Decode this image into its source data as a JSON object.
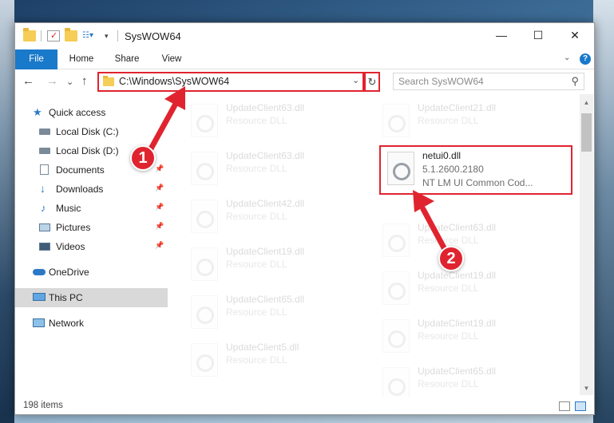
{
  "window": {
    "title": "SysWOW64",
    "minimize_glyph": "—",
    "maximize_glyph": "☐",
    "close_glyph": "✕"
  },
  "ribbon": {
    "tabs": [
      "File",
      "Home",
      "Share",
      "View"
    ],
    "collapse_glyph": "⌄",
    "help_glyph": "?"
  },
  "nav": {
    "back_glyph": "←",
    "forward_glyph": "→",
    "recent_glyph": "⌄",
    "up_glyph": "↑",
    "address": "C:\\Windows\\SysWOW64",
    "address_dropdown_glyph": "⌄",
    "refresh_glyph": "↻",
    "search_placeholder": "Search SysWOW64",
    "search_glyph": "⚲"
  },
  "sidebar": {
    "items": [
      {
        "label": "Quick access",
        "icon": "star-icon"
      },
      {
        "label": "Local Disk (C:)",
        "icon": "drive-icon"
      },
      {
        "label": "Local Disk (D:)",
        "icon": "drive-icon"
      },
      {
        "label": "Documents",
        "icon": "documents-icon"
      },
      {
        "label": "Downloads",
        "icon": "download-icon"
      },
      {
        "label": "Music",
        "icon": "music-icon"
      },
      {
        "label": "Pictures",
        "icon": "pictures-icon"
      },
      {
        "label": "Videos",
        "icon": "videos-icon"
      },
      {
        "label": "OneDrive",
        "icon": "cloud-icon"
      },
      {
        "label": "This PC",
        "icon": "computer-icon"
      },
      {
        "label": "Network",
        "icon": "network-icon"
      }
    ],
    "pin_glyph": "📌"
  },
  "files": {
    "left": [
      {
        "name": "UpdateClient63.dll",
        "desc": "Resource DLL"
      },
      {
        "name": "UpdateClient63.dll",
        "desc": "Resource DLL"
      },
      {
        "name": "UpdateClient42.dll",
        "desc": "Resource DLL"
      },
      {
        "name": "UpdateClient19.dll",
        "desc": "Resource DLL"
      },
      {
        "name": "UpdateClient65.dll",
        "desc": "Resource DLL"
      },
      {
        "name": "UpdateClient5.dll",
        "desc": "Resource DLL"
      }
    ],
    "right": [
      {
        "name": "UpdateClient21.dll",
        "desc": "Resource DLL"
      },
      {
        "name": "UpdateClient63.dll",
        "desc": "Resource DLL"
      },
      {
        "name": "UpdateClient19.dll",
        "desc": "Resource DLL"
      },
      {
        "name": "UpdateClient19.dll",
        "desc": "Resource DLL"
      },
      {
        "name": "UpdateClient65.dll",
        "desc": "Resource DLL"
      }
    ],
    "highlighted": {
      "name": "netui0.dll",
      "version": "5.1.2600.2180",
      "desc": "NT LM UI Common Cod..."
    }
  },
  "status": {
    "item_count": "198 items"
  },
  "callouts": {
    "one": "1",
    "two": "2"
  },
  "colors": {
    "accent": "#1979ca",
    "highlight": "#e0242f"
  }
}
